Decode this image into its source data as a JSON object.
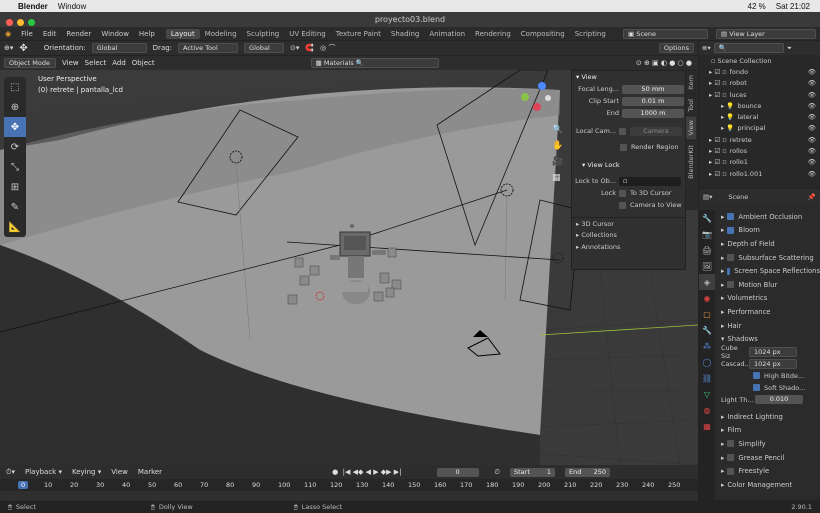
{
  "mac": {
    "app": "Blender",
    "menu": [
      "Window"
    ],
    "battery": "42 %",
    "time": "Sat 21:02"
  },
  "window": {
    "title": "proyecto03.blend"
  },
  "menubar": {
    "items": [
      "File",
      "Edit",
      "Render",
      "Window",
      "Help"
    ],
    "tabs": [
      "Layout",
      "Modeling",
      "Sculpting",
      "UV Editing",
      "Texture Paint",
      "Shading",
      "Animation",
      "Rendering",
      "Compositing",
      "Scripting"
    ],
    "scene": "Scene",
    "view_layer": "View Layer"
  },
  "header": {
    "orientation_label": "Orientation:",
    "orientation": "Global",
    "drag_label": "Drag:",
    "drag": "Active Tool",
    "transform": "Global",
    "options": "Options"
  },
  "header2": {
    "mode": "Object Mode",
    "view": "View",
    "select": "Select",
    "add": "Add",
    "object": "Object",
    "materials": "Materials"
  },
  "viewport": {
    "perspective": "User Perspective",
    "selection": "(0) retrete | pantalla_lcd"
  },
  "npanel": {
    "section_view": "View",
    "focal_label": "Focal Leng...",
    "focal": "50 mm",
    "clip_start_label": "Clip Start",
    "clip_start": "0.01 m",
    "end_label": "End",
    "end": "1000 m",
    "local_cam_label": "Local Cam...",
    "local_cam": "Camera",
    "render_region": "Render Region",
    "view_lock": "View Lock",
    "lock_to_label": "Lock to Ob...",
    "lock_label": "Lock",
    "lock_3d_cursor": "To 3D Cursor",
    "camera_to_view": "Camera to View",
    "cursor": "3D Cursor",
    "collections": "Collections",
    "annotations": "Annotations"
  },
  "vtabs": [
    "Item",
    "Tool",
    "View",
    "BlenderKit"
  ],
  "outliner": {
    "root": "Scene Collection",
    "items": [
      {
        "name": "fondo",
        "indent": 1
      },
      {
        "name": "robot",
        "indent": 1
      },
      {
        "name": "luces",
        "indent": 1
      },
      {
        "name": "bounce",
        "indent": 2
      },
      {
        "name": "lateral",
        "indent": 2
      },
      {
        "name": "principal",
        "indent": 2
      },
      {
        "name": "retrete",
        "indent": 1
      },
      {
        "name": "rollos",
        "indent": 1
      },
      {
        "name": "rollo1",
        "indent": 1
      },
      {
        "name": "rollo1.001",
        "indent": 1
      }
    ]
  },
  "props": {
    "scene": "Scene",
    "items": [
      "Ambient Occlusion",
      "Bloom",
      "Depth of Field",
      "Subsurface Scattering",
      "Screen Space Reflections",
      "Motion Blur",
      "Volumetrics",
      "Performance",
      "Hair",
      "Shadows"
    ],
    "cube_size_label": "Cube Siz",
    "cube_size": "1024 px",
    "cascade_label": "Cascad...",
    "cascade": "1024 px",
    "high_bit": "High Bitde...",
    "soft_shadows": "Soft Shado...",
    "light_threshold_label": "Light Th...",
    "light_threshold": "0.010",
    "items2": [
      "Indirect Lighting",
      "Film",
      "Simplify",
      "Grease Pencil",
      "Freestyle",
      "Color Management"
    ]
  },
  "timeline": {
    "playback": "Playback",
    "keying": "Keying",
    "view": "View",
    "marker": "Marker",
    "frame": "0",
    "start_label": "Start",
    "start": "1",
    "end_label": "End",
    "end": "250",
    "ticks": [
      "0",
      "10",
      "20",
      "30",
      "40",
      "50",
      "60",
      "70",
      "80",
      "90",
      "100",
      "110",
      "120",
      "130",
      "140",
      "150",
      "160",
      "170",
      "180",
      "190",
      "200",
      "210",
      "220",
      "230",
      "240",
      "250"
    ]
  },
  "status": {
    "select": "Select",
    "dolly": "Dolly View",
    "lasso": "Lasso Select",
    "version": "2.90.1"
  }
}
